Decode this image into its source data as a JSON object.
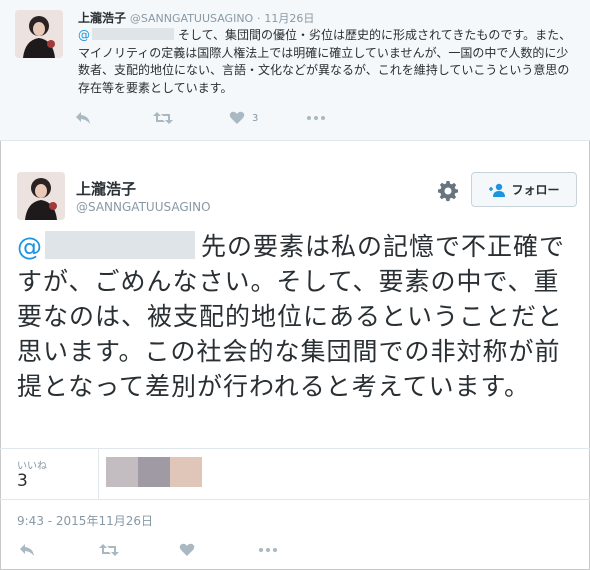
{
  "reply": {
    "author_name": "上瀧浩子",
    "author_handle": "@SANNGATUUSAGINO",
    "separator": "·",
    "date": "11月26日",
    "mention_prefix": "@",
    "text_line1": "そして、集団間の優位・劣位は歴史的に形成されてきたもので",
    "text_rest": "す。また、マイノリティの定義は国際人権法上では明確に確立していませんが、一国の中で人数的に少数者、支配的地位にない、言語・文化などが異なるが、これを維持していこうという意思の存在等を要素としています。",
    "like_count": "3",
    "icons": [
      "reply-icon",
      "retweet-icon",
      "heart-icon",
      "more-icon"
    ]
  },
  "tweet": {
    "author_name": "上瀧浩子",
    "author_handle": "@SANNGATUUSAGINO",
    "follow_label": "フォロー",
    "mention_prefix": "@",
    "text": "先の要素は私の記憶で不正確ですが、ごめんなさい。そして、要素の中で、重要なのは、被支配的地位にあるということだと思います。この社会的な集団間での非対称が前提となって差別が行われると考えています。",
    "likes_label": "いいね",
    "likes_count": "3",
    "timestamp": "9:43 - 2015年11月26日",
    "icons": [
      "reply-icon",
      "retweet-icon",
      "heart-icon",
      "more-icon",
      "gear-icon",
      "follow-person-icon"
    ]
  },
  "colors": {
    "accent": "#1b95e0",
    "muted": "#8899a6",
    "icon": "#aab8c2",
    "liker_colors": [
      "#c3bcc0",
      "#a09aa4",
      "#e0c6b9"
    ]
  }
}
